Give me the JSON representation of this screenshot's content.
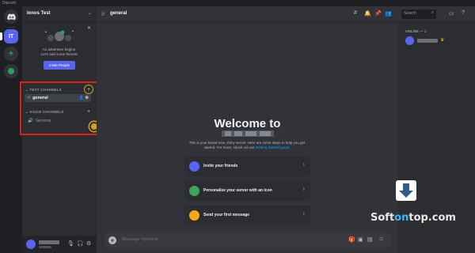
{
  "window": {
    "title": "Discord"
  },
  "rail": {
    "server_initials": "IT"
  },
  "server": {
    "name": "Ionos Test"
  },
  "invite": {
    "line1": "An adventure begins.",
    "line2": "Let's add some friends!",
    "button": "Invite People"
  },
  "categories": {
    "text": "TEXT CHANNELS",
    "voice": "VOICE CHANNELS"
  },
  "channels": {
    "text": [
      {
        "name": "general"
      }
    ],
    "voice": [
      {
        "name": "General"
      }
    ]
  },
  "header": {
    "channel": "general",
    "search_placeholder": "Search"
  },
  "welcome": {
    "title": "Welcome to",
    "subtitle": "This is your brand new, shiny server. Here are some steps to help you get started. For more, check out our",
    "link": "Getting Started guide."
  },
  "actions": [
    {
      "label": "Invite your friends",
      "icon": "invite-icon",
      "color": "#5865f2"
    },
    {
      "label": "Personalize your server with an icon",
      "icon": "personalize-icon",
      "color": "#3ba55c"
    },
    {
      "label": "Send your first message",
      "icon": "message-icon",
      "color": "#faa61a"
    }
  ],
  "composer": {
    "placeholder": "Message #general"
  },
  "members": {
    "group": "ONLINE — 1"
  },
  "watermark": {
    "part1": "Soft",
    "part2": "on",
    "part3": "top.com"
  },
  "colors": {
    "accent": "#5865f2",
    "highlight": "#e11d1d",
    "ring": "#d4a017",
    "link": "#00a8fc"
  }
}
